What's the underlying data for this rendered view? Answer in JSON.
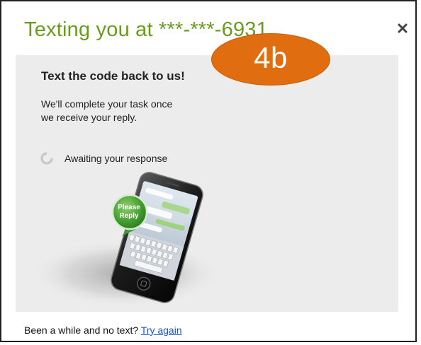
{
  "dialog": {
    "title": "Texting you at ***-***-6931",
    "close_icon": "close-icon"
  },
  "annotation": {
    "badge_text": "4b",
    "badge_color": "#e06d0f"
  },
  "panel": {
    "heading": "Text the code back to us!",
    "description_line1": "We'll complete your task once",
    "description_line2": "we receive your reply.",
    "status_text": "Awaiting your response",
    "status_icon": "spinner-icon",
    "bubble_line1": "Please",
    "bubble_line2": "Reply"
  },
  "footer": {
    "prompt": "Been a while and no text?",
    "retry_link": "Try again"
  },
  "colors": {
    "title": "#6a9b1e",
    "panel_bg": "#ececec",
    "link": "#1a55c8",
    "bubble": "#4aa83a"
  }
}
